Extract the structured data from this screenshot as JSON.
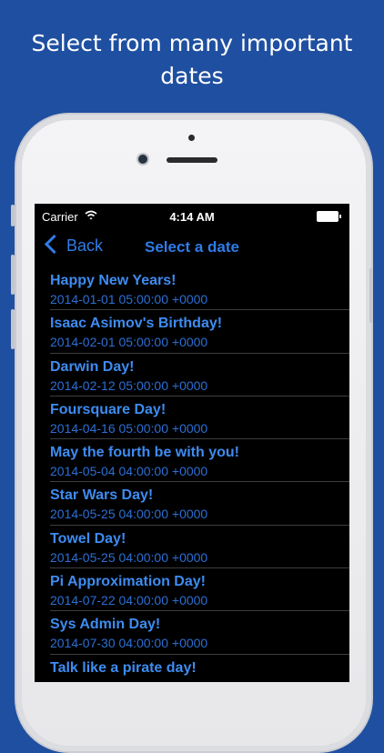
{
  "headline": {
    "line1": "Select from many important",
    "line2": "dates"
  },
  "status_bar": {
    "carrier": "Carrier",
    "time": "4:14 AM"
  },
  "nav": {
    "back_label": "Back",
    "title": "Select a date"
  },
  "dates": [
    {
      "title": "Happy New Years!",
      "datetime": "2014-01-01 05:00:00 +0000"
    },
    {
      "title": "Isaac Asimov's Birthday!",
      "datetime": "2014-02-01 05:00:00 +0000"
    },
    {
      "title": "Darwin Day!",
      "datetime": "2014-02-12 05:00:00 +0000"
    },
    {
      "title": "Foursquare Day!",
      "datetime": "2014-04-16 05:00:00 +0000"
    },
    {
      "title": "May the fourth be with you!",
      "datetime": "2014-05-04 04:00:00 +0000"
    },
    {
      "title": "Star Wars Day!",
      "datetime": "2014-05-25 04:00:00 +0000"
    },
    {
      "title": "Towel Day!",
      "datetime": "2014-05-25 04:00:00 +0000"
    },
    {
      "title": "Pi Approximation Day!",
      "datetime": "2014-07-22 04:00:00 +0000"
    },
    {
      "title": "Sys Admin Day!",
      "datetime": "2014-07-30 04:00:00 +0000"
    },
    {
      "title": "Talk like a pirate day!",
      "datetime": ""
    }
  ],
  "colors": {
    "background": "#1f4fa0",
    "accent": "#3e8cf1",
    "screen": "#000000"
  }
}
